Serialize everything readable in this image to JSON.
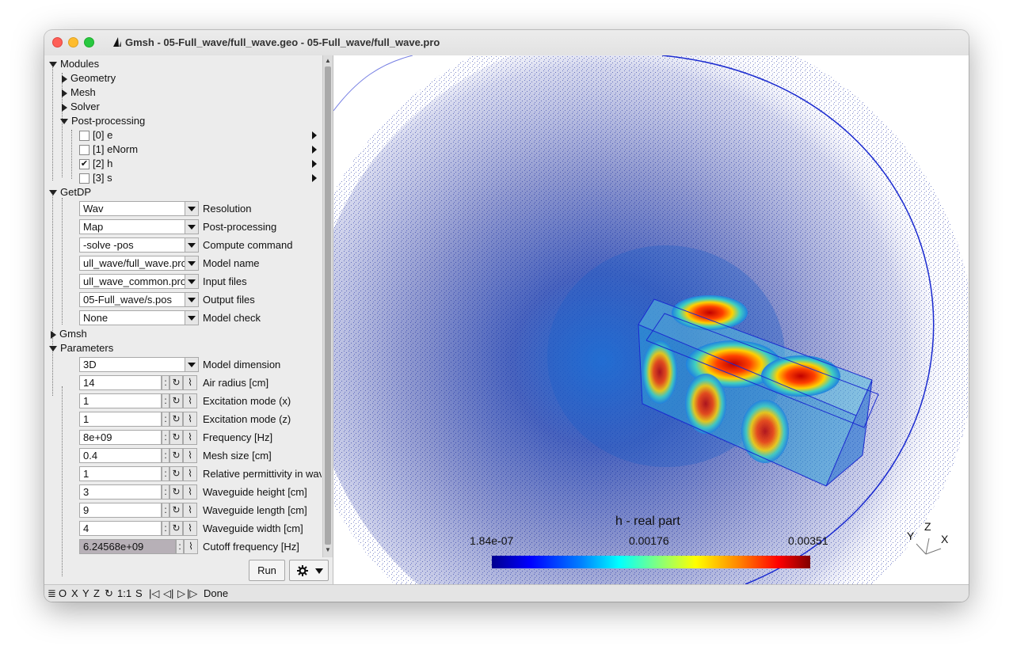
{
  "window": {
    "title": "Gmsh - 05-Full_wave/full_wave.geo - 05-Full_wave/full_wave.pro"
  },
  "tree": {
    "modules_label": "Modules",
    "module_items": [
      "Geometry",
      "Mesh",
      "Solver",
      "Post-processing"
    ],
    "views": [
      {
        "label": "[0] e",
        "checked": false
      },
      {
        "label": "[1] eNorm",
        "checked": false
      },
      {
        "label": "[2] h",
        "checked": true
      },
      {
        "label": "[3] s",
        "checked": false
      }
    ],
    "getdp_label": "GetDP",
    "gmsh_label": "Gmsh",
    "parameters_label": "Parameters"
  },
  "getdp_fields": [
    {
      "value": "Wav",
      "label": "Resolution"
    },
    {
      "value": "Map",
      "label": "Post-processing"
    },
    {
      "value": "-solve -pos",
      "label": "Compute command"
    },
    {
      "value": "ull_wave/full_wave.pro",
      "label": "Model name"
    },
    {
      "value": "ull_wave_common.pro",
      "label": "Input files"
    },
    {
      "value": "05-Full_wave/s.pos",
      "label": "Output files"
    },
    {
      "value": "None",
      "label": "Model check"
    }
  ],
  "model_dimension": {
    "value": "3D",
    "label": "Model dimension"
  },
  "parameters": [
    {
      "value": "14",
      "label": "Air radius [cm]"
    },
    {
      "value": "1",
      "label": "Excitation mode (x)"
    },
    {
      "value": "1",
      "label": "Excitation mode (z)"
    },
    {
      "value": "8e+09",
      "label": "Frequency [Hz]"
    },
    {
      "value": "0.4",
      "label": "Mesh size [cm]"
    },
    {
      "value": "1",
      "label": "Relative permittivity in wav"
    },
    {
      "value": "3",
      "label": "Waveguide height [cm]"
    },
    {
      "value": "9",
      "label": "Waveguide length [cm]"
    },
    {
      "value": "4",
      "label": "Waveguide width [cm]"
    }
  ],
  "cutoff": {
    "value": "6.24568e+09",
    "label": "Cutoff frequency [Hz]"
  },
  "buttons": {
    "run": "Run",
    "colon": ":",
    "loop_icon": "↻",
    "graph_icon": "⌇"
  },
  "statusbar": {
    "items": [
      "O",
      "X",
      "Y",
      "Z",
      "1:1",
      "S"
    ],
    "status_text": "Done"
  },
  "viewport": {
    "colorbar_title": "h - real part",
    "colorbar_min": "1.84e-07",
    "colorbar_mid": "0.00176",
    "colorbar_max": "0.00351",
    "axis_y": "Y",
    "axis_z": "Z",
    "axis_x": "X"
  }
}
